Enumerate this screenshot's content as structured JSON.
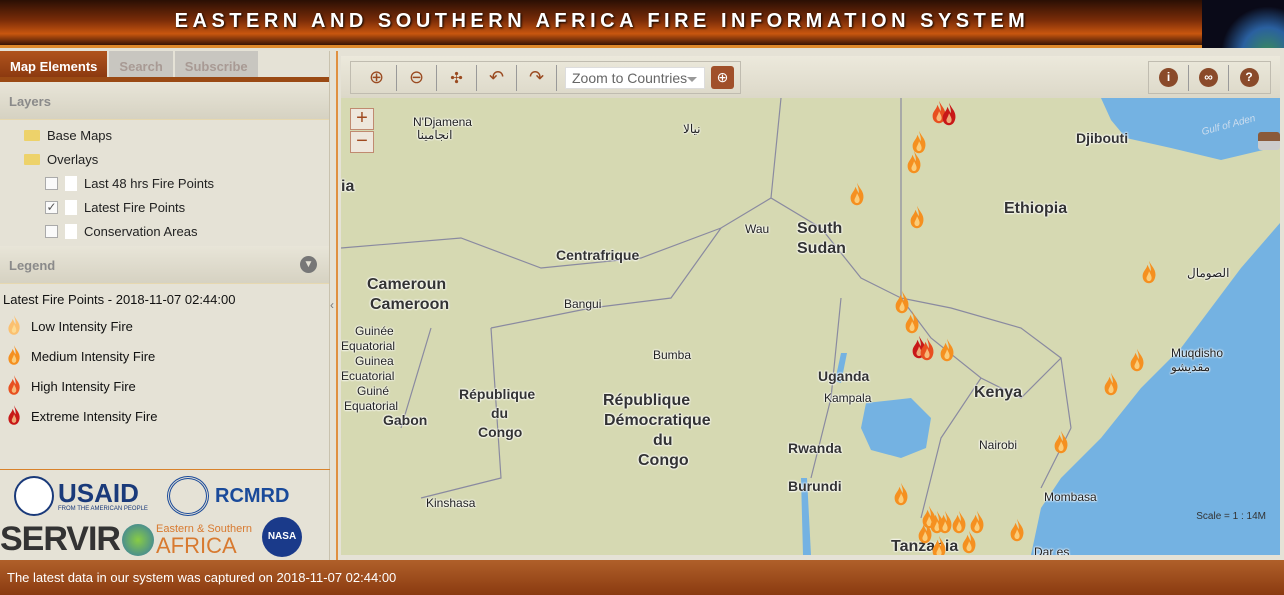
{
  "header": {
    "title": "EASTERN AND SOUTHERN AFRICA FIRE INFORMATION SYSTEM"
  },
  "sidebar": {
    "tabs": [
      {
        "label": "Map Elements",
        "active": true
      },
      {
        "label": "Search"
      },
      {
        "label": "Subscribe"
      }
    ],
    "layers": {
      "title": "Layers",
      "folders": [
        "Base Maps",
        "Overlays"
      ],
      "overlays": [
        {
          "label": "Last 48 hrs Fire Points",
          "checked": false
        },
        {
          "label": "Latest Fire Points",
          "checked": true
        },
        {
          "label": "Conservation Areas",
          "checked": false
        }
      ]
    },
    "legend": {
      "title": "Legend",
      "subtitle": "Latest Fire Points - 2018-11-07 02:44:00",
      "items": [
        {
          "label": "Low Intensity Fire",
          "color": "#fbc070"
        },
        {
          "label": "Medium Intensity Fire",
          "color": "#f59020"
        },
        {
          "label": "High Intensity Fire",
          "color": "#e85020"
        },
        {
          "label": "Extreme Intensity Fire",
          "color": "#c81818"
        }
      ]
    },
    "logos": {
      "usaid": "USAID",
      "usaid_tagline": "FROM THE AMERICAN PEOPLE",
      "rcmrd": "RCMRD",
      "servir": "SERVIR",
      "servir_region_1": "Eastern & Southern",
      "servir_region_2": "AFRICA",
      "nasa": "NASA"
    }
  },
  "toolbar": {
    "zoom_select": "Zoom to Countries",
    "icons": [
      "zoom-in",
      "zoom-out",
      "full-extent",
      "undo",
      "redo",
      "go-zoom",
      "info",
      "link",
      "help"
    ]
  },
  "map": {
    "zoom_in": "+",
    "zoom_out": "−",
    "labels": {
      "ndjamena": "N'Djamena",
      "ndjamena_ar": "انجامينا",
      "nyala": "نيالا",
      "djibouti": "Djibouti",
      "gulf": "Gulf of Aden",
      "ethiopia": "Ethiopia",
      "wau": "Wau",
      "south_sudan_1": "South",
      "south_sudan_2": "Sudan",
      "centrafrique": "Centrafrique",
      "cameroun": "Cameroun",
      "cameroon": "Cameroon",
      "bangui": "Bangui",
      "somalia_ar": "الصومال",
      "guinee": "Guinée",
      "equatorial": "Equatorial",
      "guinea": "Guinea",
      "ecuatorial": "Ecuatorial",
      "guine": "Guiné",
      "equatorial2": "Equatorial",
      "gabon": "Gabon",
      "bumba": "Bumba",
      "rep_du_congo_1": "République",
      "rep_du_congo_2": "du",
      "rep_du_congo_3": "Congo",
      "rdc_1": "République",
      "rdc_2": "Démocratique",
      "rdc_3": "du",
      "rdc_4": "Congo",
      "uganda": "Uganda",
      "kampala": "Kampala",
      "kenya": "Kenya",
      "muqdisho": "Muqdisho",
      "muqdisho_ar": "مقديشو",
      "nairobi": "Nairobi",
      "rwanda": "Rwanda",
      "burundi": "Burundi",
      "kinshasa": "Kinshasa",
      "mombasa": "Mombasa",
      "tanzania": "Tanzania",
      "dar": "Dar es",
      "edge_ia": "ia"
    },
    "scale": "Scale = 1 : 14M"
  },
  "footer": {
    "status": "The latest data in our system was captured on 2018-11-07 02:44:00"
  }
}
